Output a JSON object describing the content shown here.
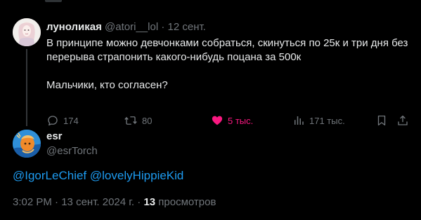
{
  "parent_tweet": {
    "display_name": "луноликая",
    "handle": "@atori__lol",
    "separator": "·",
    "date": "12 сент.",
    "text_line1": "В принципе можно девчонками собраться, скинуться по 25к и три дня без перерыва страпонить какого-нибудь поцана за 500к",
    "text_line2": "Мальчики, кто согласен?",
    "actions": {
      "replies": "174",
      "retweets": "80",
      "likes": "5 тыс.",
      "views": "171 тыс."
    }
  },
  "reply_tweet": {
    "display_name": "esr",
    "handle": "@esrTorch",
    "mention1": "@IgorLeChief",
    "mention2": "@lovelyHippieKid",
    "time": "3:02 PM",
    "separator": "·",
    "date": "13 сент. 2024 г.",
    "separator2": "·",
    "views_count": "13",
    "views_label": "просмотров"
  },
  "colors": {
    "background": "#000000",
    "text": "#e7e9ea",
    "muted": "#71767b",
    "accent": "#1d9bf0",
    "like": "#f91880"
  },
  "icons": [
    "reply-icon",
    "retweet-icon",
    "heart-icon",
    "views-icon",
    "bookmark-icon",
    "share-icon"
  ]
}
